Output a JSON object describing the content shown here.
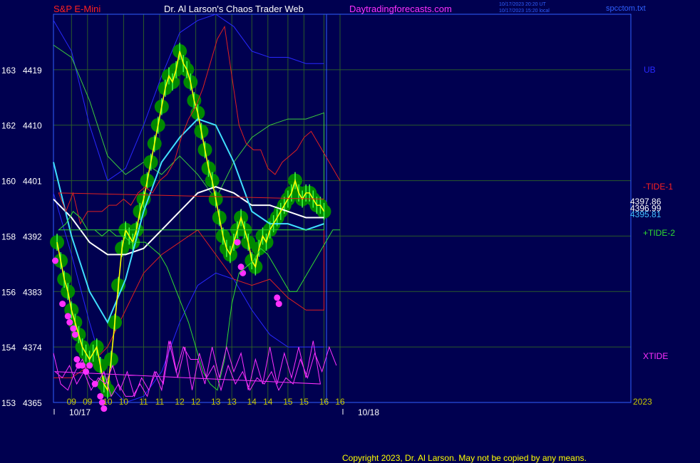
{
  "header": {
    "symbol": "S&P E-Mini",
    "site_title": "Dr. Al Larson's Chaos Trader Web",
    "site_url": "Daytradingforecasts.com",
    "timestamp_ut": "10/17/2023 20:20 UT",
    "timestamp_local": "10/17/2023 15:20 local",
    "file_name": "spcctom.txt"
  },
  "footer": {
    "copyright": "Copyright 2023, Dr. Al Larson. May not be copied by any means."
  },
  "colors": {
    "background": "#000050",
    "grid": "#2a5a2a",
    "price_fill": "#008800",
    "price_line": "#ffff00",
    "fast_ma": "#40e0ff",
    "slow_ma": "#ffffff",
    "upper_band": "#2828ff",
    "upper_env": "#3ccc3c",
    "lower_env": "#dd2020",
    "markers": "#ff30ff",
    "tide1": "#e02020",
    "tide2": "#30dd30",
    "xtide": "#ff30ff",
    "separator": "#3060ff"
  },
  "chart_data": {
    "type": "line",
    "title": "S&P E-Mini",
    "xlabel": "",
    "ylabel": "",
    "ylim": [
      4365,
      4428
    ],
    "xlim": [
      8.5,
      16.6
    ],
    "grid": true,
    "y_ticks": [
      {
        "value": 4419,
        "cycle": "163",
        "price": "4419"
      },
      {
        "value": 4410,
        "cycle": "162",
        "price": "4410"
      },
      {
        "value": 4401,
        "cycle": "160",
        "price": "4401"
      },
      {
        "value": 4392,
        "cycle": "158",
        "price": "4392"
      },
      {
        "value": 4383,
        "cycle": "156",
        "price": "4383"
      },
      {
        "value": 4374,
        "cycle": "154",
        "price": "4374"
      },
      {
        "value": 4365,
        "cycle": "153",
        "price": "4365"
      }
    ],
    "x_ticks_day1": [
      {
        "value": 9,
        "label": "09"
      },
      {
        "value": 10,
        "label": "10"
      },
      {
        "value": 11,
        "label": "11"
      },
      {
        "value": 12,
        "label": "12"
      },
      {
        "value": 13,
        "label": "13"
      },
      {
        "value": 14,
        "label": "14"
      },
      {
        "value": 15,
        "label": "15"
      },
      {
        "value": 16,
        "label": "16"
      }
    ],
    "x_ticks_day2": [
      {
        "value": 9,
        "label": "09"
      },
      {
        "value": 10,
        "label": "10"
      },
      {
        "value": 11,
        "label": "11"
      },
      {
        "value": 12,
        "label": "12"
      },
      {
        "value": 13,
        "label": "13"
      },
      {
        "value": 14,
        "label": "14"
      },
      {
        "value": 15,
        "label": "15"
      },
      {
        "value": 16,
        "label": "16"
      }
    ],
    "date_labels": [
      "10/17",
      "10/18"
    ],
    "year_label": "2023",
    "series": [
      {
        "name": "Price",
        "role": "price",
        "x": [
          8.6,
          8.7,
          8.8,
          8.9,
          9.0,
          9.1,
          9.2,
          9.3,
          9.4,
          9.5,
          9.6,
          9.7,
          9.8,
          9.9,
          10.0,
          10.1,
          10.2,
          10.3,
          10.4,
          10.5,
          10.6,
          10.7,
          10.8,
          10.9,
          11.0,
          11.1,
          11.2,
          11.3,
          11.4,
          11.5,
          11.6,
          11.7,
          11.8,
          11.9,
          12.0,
          12.1,
          12.2,
          12.3,
          12.4,
          12.5,
          12.6,
          12.7,
          12.8,
          12.9,
          13.0,
          13.1,
          13.2,
          13.3,
          13.4,
          13.5,
          13.6,
          13.7,
          13.8,
          13.9,
          14.0,
          14.1,
          14.2,
          14.3,
          14.4,
          14.5,
          14.6,
          14.7,
          14.8,
          14.9,
          15.0,
          15.1,
          15.2,
          15.3,
          15.4,
          15.5,
          15.6,
          15.7,
          15.8,
          15.9,
          16.0
        ],
        "y": [
          4391,
          4388,
          4385,
          4383,
          4380,
          4378,
          4376,
          4374,
          4373,
          4372,
          4373,
          4374,
          4371,
          4368,
          4367,
          4372,
          4378,
          4384,
          4390,
          4393,
          4392,
          4391,
          4393,
          4396,
          4398,
          4401,
          4404,
          4407,
          4410,
          4413,
          4416,
          4418,
          4417,
          4419,
          4422,
          4420,
          4419,
          4417,
          4414,
          4412,
          4409,
          4406,
          4403,
          4401,
          4398,
          4395,
          4392,
          4390,
          4389,
          4391,
          4393,
          4395,
          4393,
          4391,
          4388,
          4387,
          4390,
          4392,
          4391,
          4393,
          4394,
          4395,
          4396,
          4397,
          4398,
          4399,
          4401,
          4399,
          4398,
          4399,
          4399,
          4398,
          4397,
          4397,
          4396
        ]
      },
      {
        "name": "Fast MA",
        "role": "fast_ma",
        "x": [
          8.5,
          9.0,
          9.5,
          10.0,
          10.5,
          11.0,
          11.5,
          12.0,
          12.5,
          13.0,
          13.5,
          14.0,
          14.5,
          15.0,
          15.5,
          16.0
        ],
        "y": [
          4404,
          4392,
          4383,
          4378,
          4385,
          4396,
          4404,
          4408,
          4411,
          4410,
          4404,
          4396,
          4394,
          4394,
          4393,
          4394
        ]
      },
      {
        "name": "Slow MA",
        "role": "slow_ma",
        "x": [
          8.5,
          9.0,
          9.5,
          10.0,
          10.5,
          11.0,
          11.5,
          12.0,
          12.5,
          13.0,
          13.5,
          14.0,
          14.5,
          15.0,
          15.5,
          16.0
        ],
        "y": [
          4398,
          4395,
          4391,
          4389,
          4389,
          4390,
          4393,
          4396,
          4399,
          4400,
          4399,
          4397,
          4397,
          4396,
          4395,
          4395
        ]
      },
      {
        "name": "Upper Band",
        "role": "upper_band",
        "x": [
          8.5,
          9.0,
          9.5,
          10.0,
          10.5,
          11.0,
          11.5,
          12.0,
          12.5,
          13.0,
          13.5,
          14.0,
          14.5,
          15.0,
          15.5,
          16.0
        ],
        "y": [
          4427,
          4422,
          4410,
          4401,
          4403,
          4410,
          4418,
          4425,
          4427,
          4428,
          4426,
          4422,
          4421,
          4421,
          4420,
          4420
        ]
      },
      {
        "name": "Upper Envelope",
        "role": "upper_env",
        "x": [
          8.5,
          9.0,
          9.5,
          10.0,
          10.5,
          11.0,
          11.5,
          12.0,
          12.5,
          13.0,
          13.5,
          14.0,
          14.5,
          15.0,
          15.5,
          16.0,
          16.0
        ],
        "y": [
          4423,
          4421,
          4414,
          4405,
          4402,
          4404,
          4402,
          4405,
          4402,
          4398,
          4404,
          4408,
          4410,
          4411,
          4411,
          4412,
          4393
        ]
      },
      {
        "name": "Lower Envelope",
        "role": "lower_env",
        "x": [
          8.5,
          9.0,
          9.5,
          10.0,
          10.5,
          11.0,
          11.5,
          12.0,
          12.5,
          13.0,
          13.5,
          14.0,
          14.5,
          15.0,
          15.5,
          16.0,
          16.0
        ],
        "y": [
          4369,
          4369,
          4371,
          4374,
          4380,
          4386,
          4389,
          4391,
          4393,
          4389,
          4385,
          4384,
          4385,
          4382,
          4380,
          4380,
          4393
        ]
      },
      {
        "name": "Lower Band",
        "role": "lower_band",
        "x": [
          8.5,
          9.0,
          9.5,
          10.0,
          10.5,
          11.0,
          11.5,
          12.0,
          12.5,
          13.0,
          13.5,
          14.0,
          14.5,
          15.0,
          15.5,
          16.0
        ],
        "y": [
          4399,
          4389,
          4378,
          4368,
          4365,
          4366,
          4370,
          4378,
          4384,
          4386,
          4385,
          4380,
          4376,
          4374,
          4374,
          4374
        ]
      },
      {
        "name": "-TIDE-1",
        "role": "tide1",
        "x": [
          16.0,
          16.2,
          16.4,
          16.6,
          16.8,
          17.0,
          17.2,
          17.4,
          17.6,
          17.8,
          18.0,
          18.2,
          18.4,
          18.6,
          18.8,
          19.0,
          19.2,
          19.4,
          19.6,
          19.8,
          20.0,
          20.2,
          20.4,
          20.6,
          20.8,
          21.0,
          21.2,
          21.4,
          21.6,
          21.8,
          22.0,
          22.2,
          22.4,
          22.6,
          22.8,
          23.0,
          23.2,
          23.4,
          23.6,
          23.8,
          24.0
        ],
        "y": [
          4398,
          4399,
          4396,
          4399,
          4394,
          4396,
          4396,
          4396,
          4397,
          4397,
          4398,
          4397,
          4399,
          4400,
          4399,
          4401,
          4402,
          4404,
          4408,
          4411,
          4413,
          4416,
          4420,
          4424,
          4426,
          4418,
          4410,
          4407,
          4406,
          4406,
          4403,
          4402,
          4404,
          4405,
          4406,
          4408,
          4409,
          4407,
          4405,
          4403,
          4401
        ]
      },
      {
        "name": "+TIDE-2",
        "role": "tide2",
        "x": [
          16.0,
          16.2,
          16.4,
          16.6,
          16.8,
          17.0,
          17.2,
          17.4,
          17.6,
          17.8,
          18.0,
          18.2,
          18.4,
          18.6,
          18.8,
          19.0,
          19.2,
          19.4,
          19.6,
          19.8,
          20.0,
          20.2,
          20.4,
          20.6,
          20.8,
          21.0,
          21.2,
          21.4,
          21.6,
          21.8,
          22.0,
          22.2,
          22.4,
          22.6,
          22.8,
          23.0,
          23.2,
          23.4,
          23.6,
          23.8,
          24.0
        ],
        "y": [
          4393,
          4393,
          4394,
          4396,
          4395,
          4393,
          4393,
          4392,
          4393,
          4392,
          4392,
          4391,
          4391,
          4391,
          4390,
          4389,
          4387,
          4384,
          4381,
          4378,
          4374,
          4370,
          4368,
          4367,
          4372,
          4381,
          4386,
          4387,
          4388,
          4390,
          4389,
          4387,
          4385,
          4383,
          4383,
          4385,
          4387,
          4389,
          4391,
          4393,
          4393
        ]
      },
      {
        "name": "XTIDE",
        "role": "xtide",
        "x": [
          8.5,
          8.7,
          8.9,
          9.1,
          9.3,
          9.5,
          9.7,
          9.9,
          10.1,
          10.3,
          10.5,
          10.7,
          10.9,
          11.1,
          11.3,
          11.5,
          11.7,
          11.9,
          12.1,
          12.3,
          12.5,
          12.7,
          12.9,
          13.1,
          13.3,
          13.5,
          13.7,
          13.9,
          14.1,
          14.3,
          14.5,
          14.7,
          14.9,
          15.1,
          15.3,
          15.5,
          15.7,
          15.9,
          16.1,
          16.3,
          16.5,
          16.7,
          16.9,
          17.1,
          17.3,
          17.5,
          17.7,
          17.9,
          18.1,
          18.3,
          18.5,
          18.7,
          18.9,
          19.1,
          19.3,
          19.5,
          19.7,
          19.9,
          20.1,
          20.3,
          20.5,
          20.7,
          20.9,
          21.1,
          21.3,
          21.5,
          21.7,
          21.9,
          22.1,
          22.3,
          22.5,
          22.7,
          22.9,
          23.1,
          23.3,
          23.5,
          23.7,
          23.9
        ],
        "y": [
          4373,
          4368,
          4367,
          4370,
          4372,
          4369,
          4368,
          4370,
          4366,
          4368,
          4366,
          4366,
          4368,
          4366,
          4370,
          4367,
          4375,
          4370,
          4374,
          4372,
          4372,
          4368,
          4374,
          4369,
          4374,
          4370,
          4373,
          4367,
          4372,
          4368,
          4374,
          4368,
          4373,
          4369,
          4374,
          4369,
          4375,
          4368,
          4370,
          4369,
          4371,
          4368,
          4370,
          4367,
          4369,
          4368,
          4371,
          4367,
          4370,
          4366,
          4369,
          4367,
          4370,
          4368,
          4375,
          4369,
          4374,
          4367,
          4373,
          4369,
          4371,
          4367,
          4371,
          4368,
          4370,
          4367,
          4369,
          4368,
          4370,
          4367,
          4369,
          4368,
          4372,
          4369,
          4373,
          4370,
          4374,
          4371
        ]
      }
    ],
    "markers": {
      "x": [
        8.55,
        8.75,
        8.9,
        8.95,
        9.05,
        9.1,
        9.15,
        9.2,
        9.3,
        9.4,
        9.5,
        9.65,
        9.8,
        9.85,
        9.9,
        13.6,
        13.7,
        13.75,
        14.7,
        14.75
      ],
      "y": [
        4388,
        4381,
        4379,
        4378,
        4377,
        4376,
        4372,
        4371,
        4371,
        4370,
        4371,
        4368,
        4366,
        4365,
        4364,
        4391,
        4387,
        4386,
        4382,
        4381
      ]
    },
    "right_labels": [
      {
        "text": "UB",
        "value": 4419,
        "color": "#2828ff"
      },
      {
        "text": "-TIDE-1",
        "value": 4400,
        "color": "#ff2020"
      },
      {
        "text": "4397.86",
        "value": 4397.6,
        "color": "#ffffff"
      },
      {
        "text": "4396.99",
        "value": 4396.5,
        "color": "#ffffff"
      },
      {
        "text": "4395.81",
        "value": 4395.5,
        "color": "#40c0ff"
      },
      {
        "text": "+TIDE-2",
        "value": 4392.5,
        "color": "#30dd30"
      },
      {
        "text": "XTIDE",
        "value": 4372.5,
        "color": "#ff30ff"
      }
    ]
  }
}
